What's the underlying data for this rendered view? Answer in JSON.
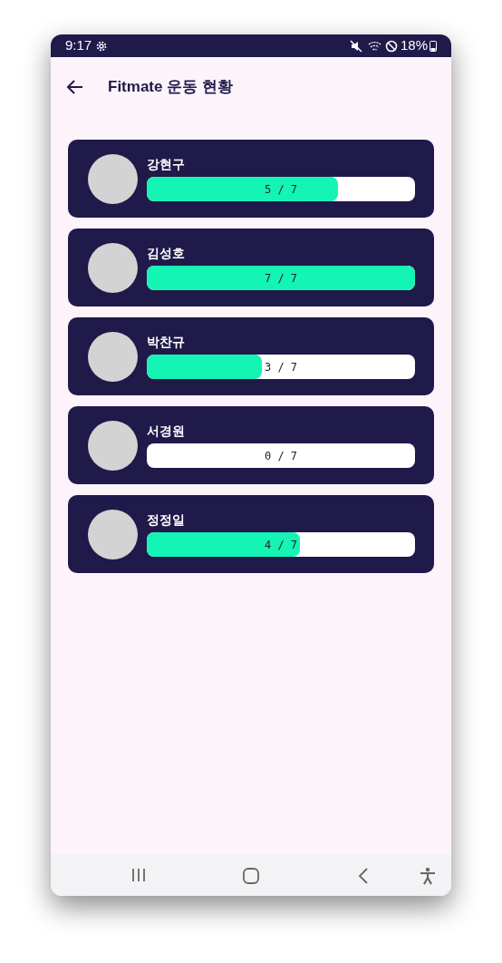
{
  "status_bar": {
    "time": "9:17",
    "battery": "18%"
  },
  "app_bar": {
    "title": "Fitmate 운동 현황"
  },
  "members": [
    {
      "name": "강현구",
      "progress": "5 / 7",
      "level": 0.714
    },
    {
      "name": "김성호",
      "progress": "7 / 7",
      "level": 1
    },
    {
      "name": "박찬규",
      "progress": "3 / 7",
      "level": 0.429
    },
    {
      "name": "서경원",
      "progress": "0 / 7"
    },
    {
      "name": "정정일",
      "progress": "4 / 7",
      "level": 0.571
    }
  ]
}
